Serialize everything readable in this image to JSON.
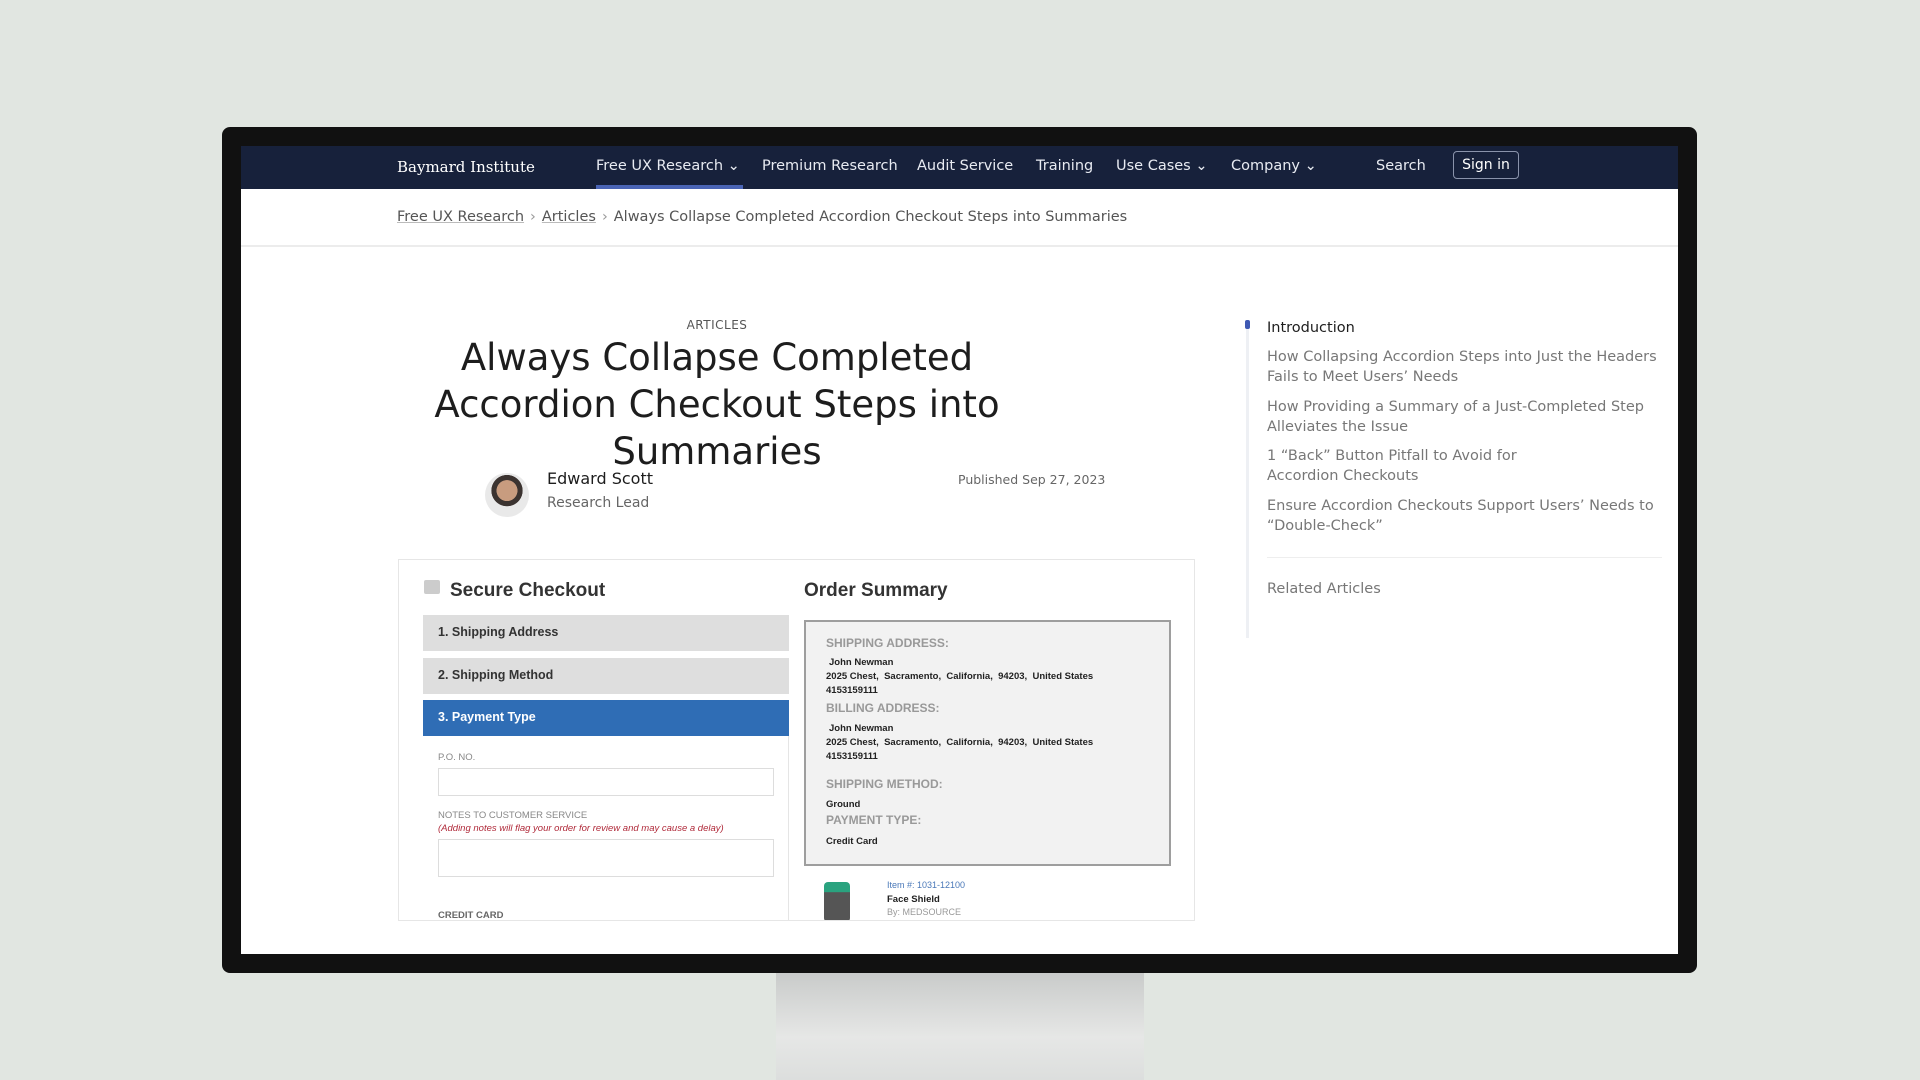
{
  "nav": {
    "logo": "Baymard Institute",
    "items": [
      "Free UX Research",
      "Premium Research",
      "Audit Service",
      "Training",
      "Use Cases",
      "Company"
    ],
    "search": "Search",
    "signin": "Sign in"
  },
  "breadcrumb": [
    "Free UX Research",
    "Articles",
    "Always Collapse Completed Accordion Checkout Steps into Summaries"
  ],
  "article": {
    "kicker": "ARTICLES",
    "title": "Always Collapse Completed Accordion Checkout Steps into Summaries",
    "author": "Edward Scott",
    "role": "Research Lead",
    "published": "Published Sep 27, 2023"
  },
  "figure": {
    "checkout_title": "Secure Checkout",
    "steps": [
      "1. Shipping Address",
      "2. Shipping Method",
      "3. Payment Type"
    ],
    "po_label": "P.O. NO.",
    "notes_label": "NOTES TO CUSTOMER SERVICE",
    "notes_warning": "(Adding notes will flag your order for review and may cause a delay)",
    "credit_label": "CREDIT CARD",
    "summary_title": "Order Summary",
    "shipping_address_h": "SHIPPING ADDRESS:",
    "name": "John Newman",
    "address": "2025 Chest,  Sacramento,  California,  94203,  United States",
    "phone": "4153159111",
    "billing_address_h": "BILLING ADDRESS:",
    "shipping_method_h": "SHIPPING METHOD:",
    "shipping_method": "Ground",
    "payment_type_h": "PAYMENT TYPE:",
    "payment_type": "Credit Card",
    "item_no": "Item #: 1031-12100",
    "item_name": "Face Shield",
    "item_by": "By: MEDSOURCE"
  },
  "toc": {
    "items": [
      "Introduction",
      "How Collapsing Accordion Steps into Just the Headers Fails to Meet Users’ Needs",
      "How Providing a Summary of a Just-Completed Step Alleviates the Issue",
      "1 “Back” Button Pitfall to Avoid for Accordion Checkouts",
      "Ensure Accordion Checkouts Support Users’ Needs to “Double-Check”"
    ],
    "related": "Related Articles"
  }
}
